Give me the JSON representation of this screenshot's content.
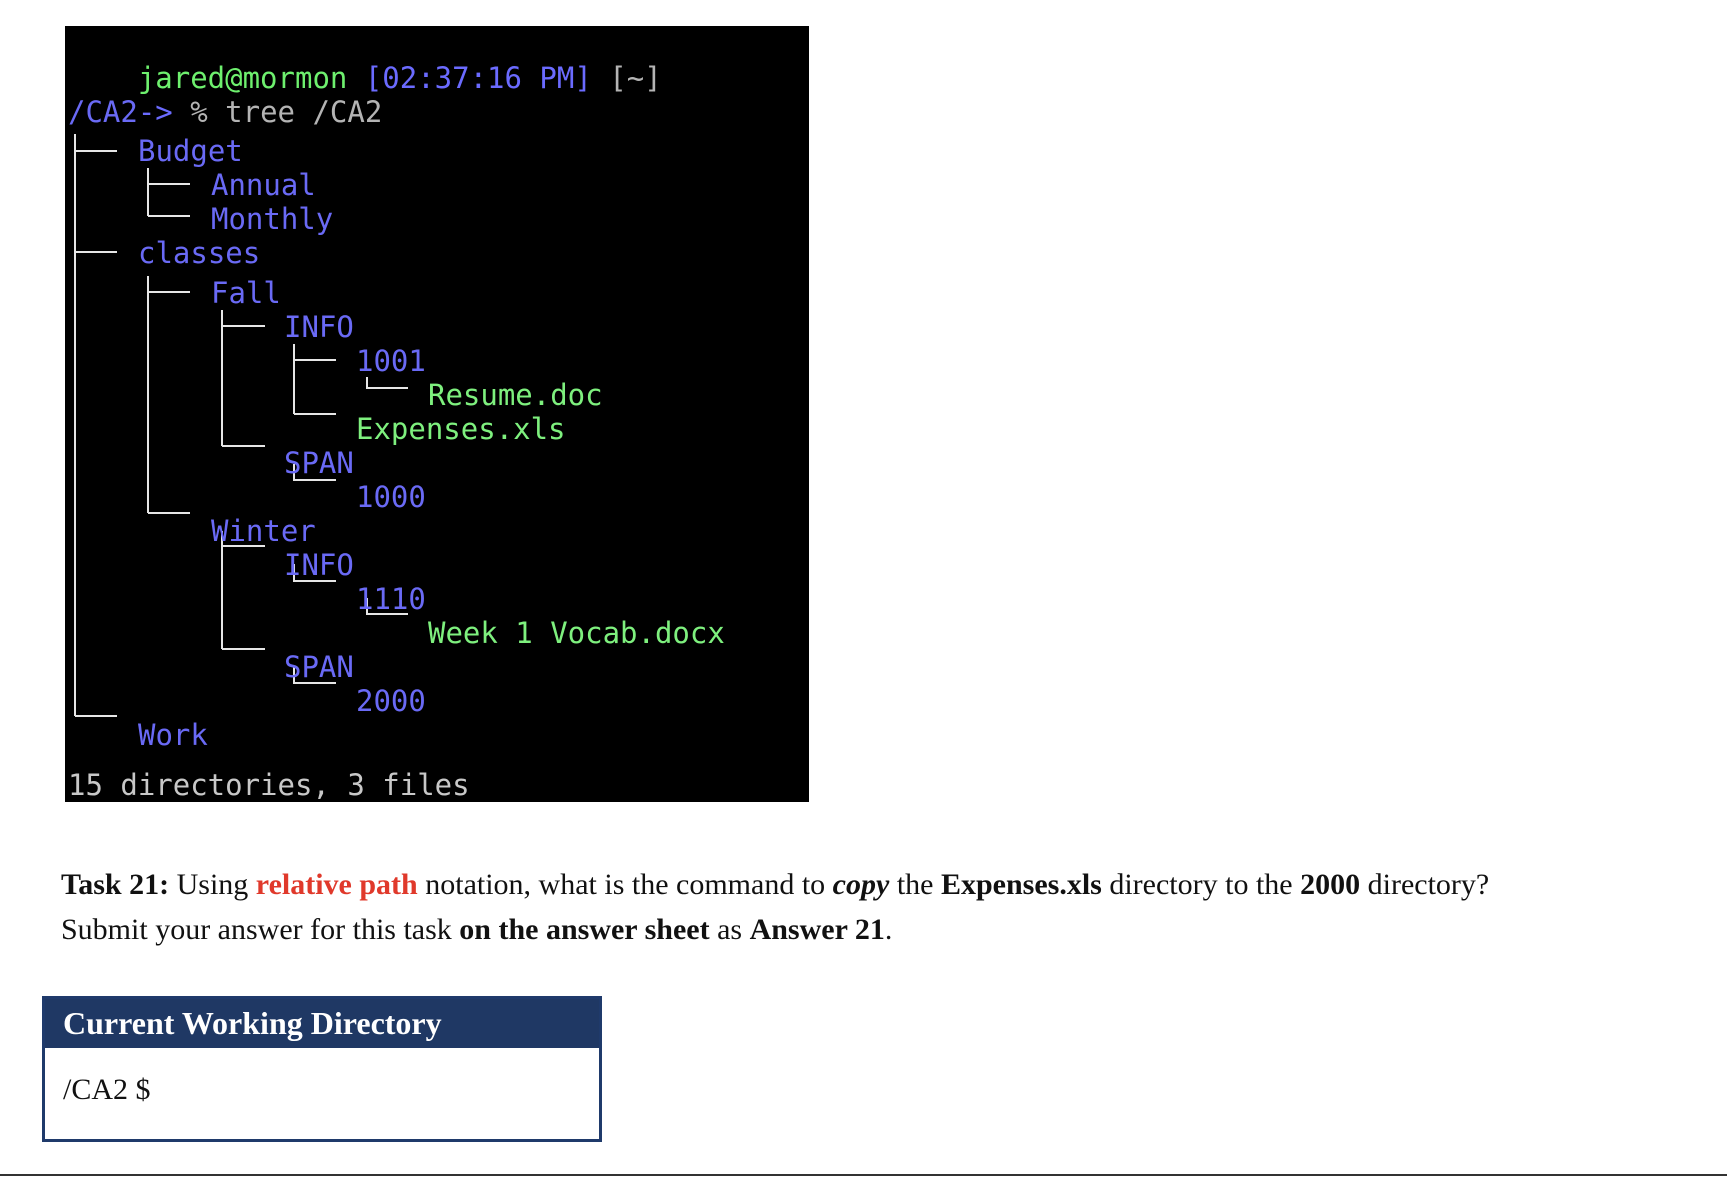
{
  "terminal": {
    "prompt_user": "jared@mormon",
    "prompt_time": "[02:37:16 PM]",
    "prompt_dir": "[~]",
    "prompt_arrow": "->",
    "prompt_symbol": "%",
    "command": "tree /CA2",
    "tree": {
      "root": "/CA2",
      "budget": "Budget",
      "annual": "Annual",
      "monthly": "Monthly",
      "classes": "classes",
      "fall": "Fall",
      "fall_info": "INFO",
      "d1001": "1001",
      "resume": "Resume.doc",
      "expenses": "Expenses.xls",
      "fall_span": "SPAN",
      "d1000": "1000",
      "winter": "Winter",
      "winter_info": "INFO",
      "d1110": "1110",
      "vocab": "Week 1 Vocab.docx",
      "winter_span": "SPAN",
      "d2000": "2000",
      "work": "Work"
    },
    "summary": "15 directories, 3 files"
  },
  "task": {
    "label": "Task 21:",
    "t1": "Using",
    "relative_path": "relative path",
    "t2": "notation, what is the command to",
    "copy": "copy",
    "t3": "the",
    "expenses": "Expenses.xls",
    "t4": "directory to the",
    "dir2000": "2000",
    "t5": "directory?",
    "t6": "Submit your answer for this task",
    "answer_sheet": "on the answer sheet",
    "t7": "as",
    "answer": "Answer 21",
    "t8": "."
  },
  "cwd": {
    "header": "Current Working Directory",
    "value": "/CA2 $"
  },
  "colors": {
    "terminal_bg": "#000000",
    "dir_blue": "#6a6af5",
    "file_green": "#7ef07e",
    "highlight_red": "#e0392b",
    "header_navy": "#1f3864"
  }
}
